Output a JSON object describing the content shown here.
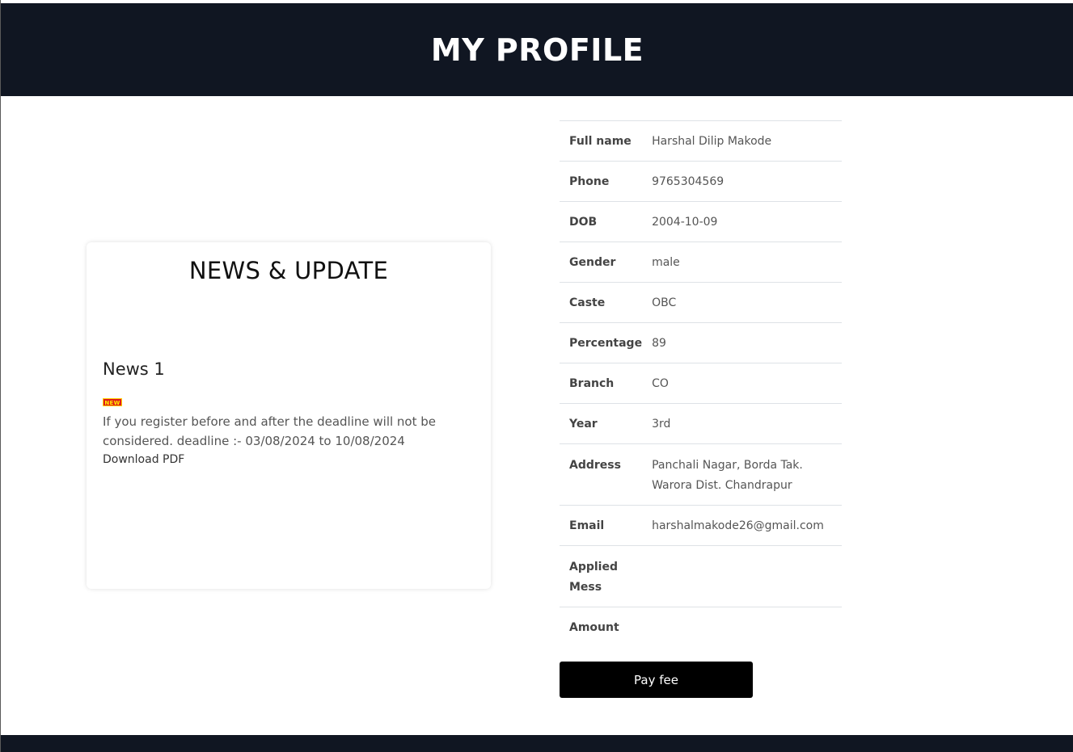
{
  "header": {
    "title": "MY PROFILE"
  },
  "news": {
    "heading": "NEWS & UPDATE",
    "items": [
      {
        "title": "News 1",
        "badge": "NEW",
        "text": "If you register before and after the deadline will not be considered. deadline :- 03/08/2024 to 10/08/2024",
        "link_label": "Download PDF"
      }
    ]
  },
  "profile": {
    "fields": [
      {
        "label": "Full name",
        "value": "Harshal Dilip Makode"
      },
      {
        "label": "Phone",
        "value": "9765304569"
      },
      {
        "label": "DOB",
        "value": "2004-10-09"
      },
      {
        "label": "Gender",
        "value": "male"
      },
      {
        "label": "Caste",
        "value": "OBC"
      },
      {
        "label": "Percentage",
        "value": "89"
      },
      {
        "label": "Branch",
        "value": "CO"
      },
      {
        "label": "Year",
        "value": "3rd"
      },
      {
        "label": "Address",
        "value": "Panchali Nagar, Borda Tak. Warora Dist. Chandrapur"
      },
      {
        "label": "Email",
        "value": "harshalmakode26@gmail.com"
      },
      {
        "label": "Applied Mess",
        "value": ""
      },
      {
        "label": "Amount",
        "value": ""
      }
    ],
    "pay_button_label": "Pay fee"
  },
  "colors": {
    "header_bg": "#101622",
    "badge_bg": "#e01b1b",
    "badge_text": "#ffeb00",
    "button_bg": "#000000"
  }
}
